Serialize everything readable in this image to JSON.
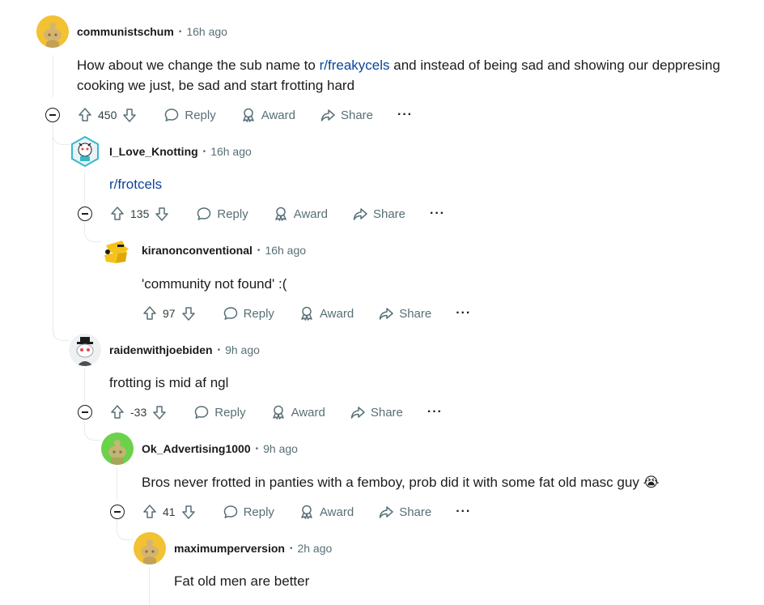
{
  "comments": [
    {
      "username": "communistschum",
      "time": "16h ago",
      "body_pre": "How about we change the sub name to ",
      "body_link": "r/freakycels",
      "body_post_1": " and instead of being sad and showing our deppresing",
      "body_line2": "cooking we just, be sad and start frotting hard",
      "score": "450",
      "avatar_color": "#f2c232"
    },
    {
      "username": "I_Love_Knotting",
      "time": "16h ago",
      "body_link": "r/frotcels",
      "score": "135",
      "avatar_color": "#3ab8c9"
    },
    {
      "username": "kiranonconventional",
      "time": "16h ago",
      "body": "'community not found' :(",
      "score": "97",
      "avatar_color": "#f4c21b"
    },
    {
      "username": "raidenwithjoebiden",
      "time": "9h ago",
      "body": "frotting is mid af ngl",
      "score": "-33",
      "avatar_color": "#9aa0a3"
    },
    {
      "username": "Ok_Advertising1000",
      "time": "9h ago",
      "body": "Bros never frotted in panties with a femboy, prob did it with some fat old masc guy",
      "score": "41",
      "avatar_color": "#6cd14b",
      "emoji": "😭"
    },
    {
      "username": "maximumperversion",
      "time": "2h ago",
      "body": "Fat old men are better",
      "avatar_color": "#f2c232"
    }
  ],
  "labels": {
    "reply": "Reply",
    "award": "Award",
    "share": "Share",
    "more": "···",
    "dot": "•"
  }
}
